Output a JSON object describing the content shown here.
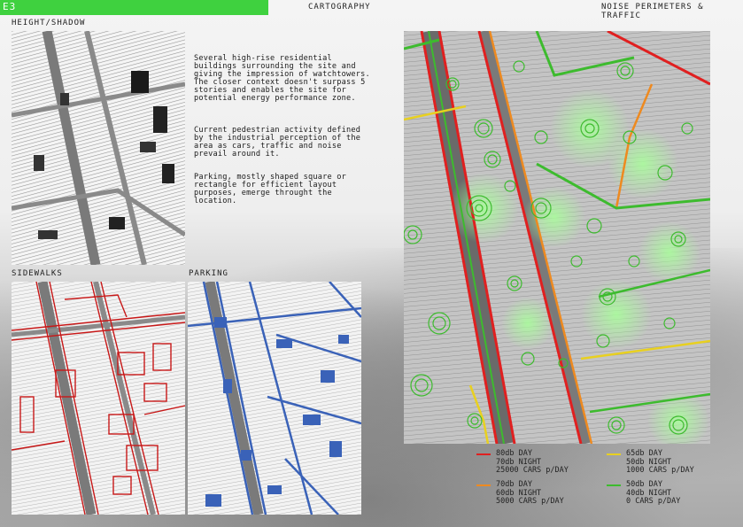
{
  "header": {
    "section_tag": "E3",
    "center_title": "CARTOGRAPHY",
    "right_title": "NOISE PERIMETERS & TRAFFIC"
  },
  "maps": {
    "height_shadow_label": "HEIGHT/SHADOW",
    "sidewalks_label": "SIDEWALKS",
    "parking_label": "PARKING"
  },
  "description": {
    "p1": "Several high-rise residential buildings surrounding the site and giving the impression of watchtowers. The closer context doesn't surpass 5 stories and enables the site for potential energy performance zone.",
    "p2": "Current pedestrian activity defined by the industrial perception of the area as cars, traffic and noise prevail around it.",
    "p3": "Parking, mostly shaped square or rectangle for efficient layout purposes, emerge throught the location."
  },
  "legend": [
    {
      "day": "80db DAY",
      "night": "70db NIGHT",
      "traffic": "25000 CARS p/DAY",
      "color": "#e02020"
    },
    {
      "day": "65db DAY",
      "night": "50db NIGHT",
      "traffic": "1000 CARS p/DAY",
      "color": "#e8d020"
    },
    {
      "day": "70db DAY",
      "night": "60db NIGHT",
      "traffic": "5000 CARS p/DAY",
      "color": "#ee8a20"
    },
    {
      "day": "50db DAY",
      "night": "40db NIGHT",
      "traffic": "0 CARS p/DAY",
      "color": "#3dbb2e"
    }
  ],
  "colors": {
    "accent_green": "#3fd13f",
    "sidewalk_red": "#c81818",
    "parking_blue": "#3a62b8"
  }
}
